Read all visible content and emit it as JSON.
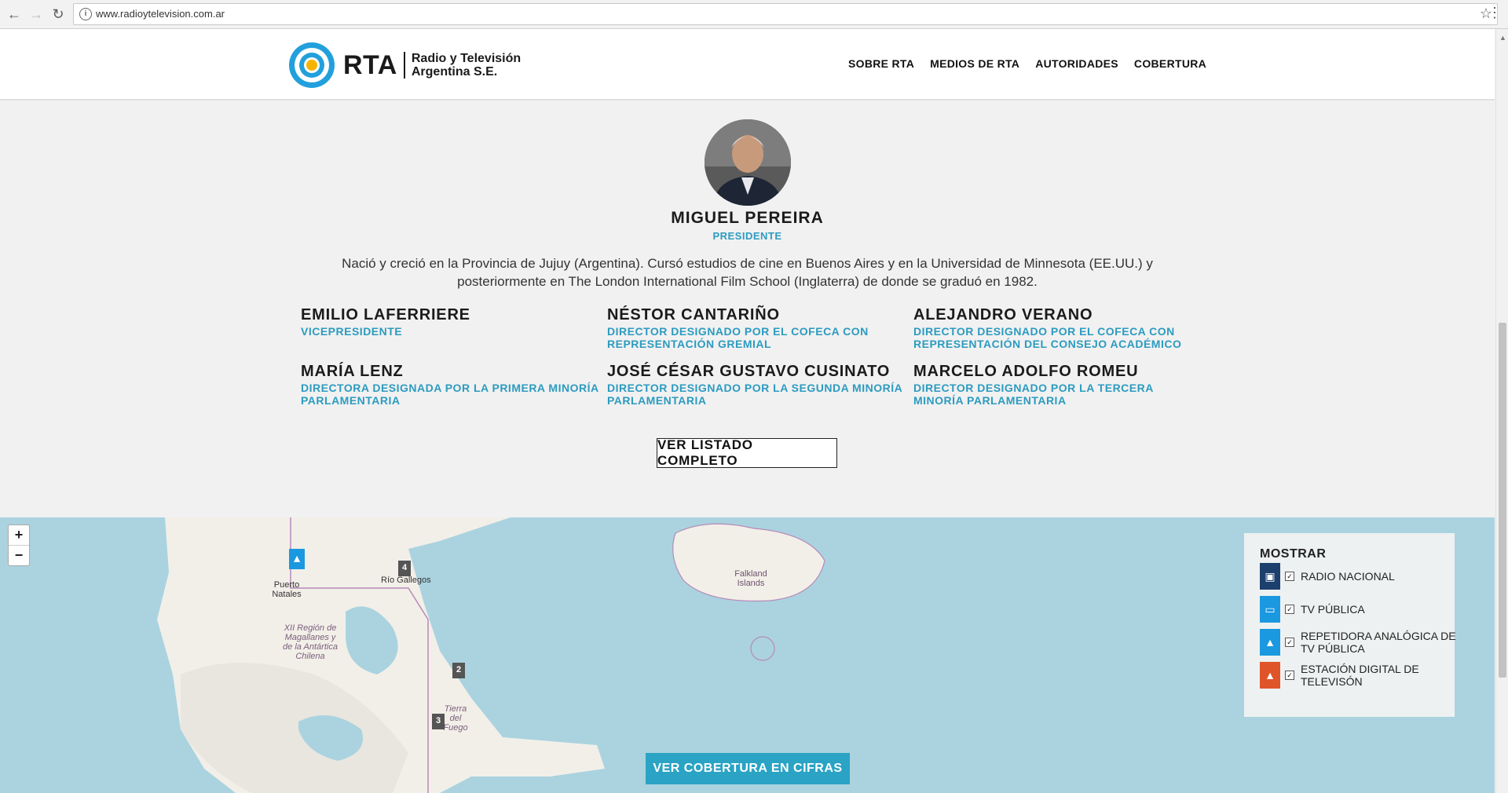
{
  "browser": {
    "url": "www.radioytelevision.com.ar"
  },
  "header": {
    "logo_abbr": "RTA",
    "logo_line1": "Radio y Televisión",
    "logo_line2": "Argentina S.E.",
    "nav": [
      "SOBRE RTA",
      "MEDIOS DE RTA",
      "AUTORIDADES",
      "COBERTURA"
    ]
  },
  "president": {
    "name": "MIGUEL PEREIRA",
    "role": "PRESIDENTE",
    "bio": "Nació y creció en la Provincia de Jujuy (Argentina). Cursó estudios de cine en Buenos Aires y en la Universidad de Minnesota (EE.UU.) y posteriormente en The London International Film School (Inglaterra) de donde se graduó en 1982."
  },
  "members": [
    {
      "name": "EMILIO LAFERRIERE",
      "role": "VICEPRESIDENTE"
    },
    {
      "name": "NÉSTOR CANTARIÑO",
      "role": "DIRECTOR DESIGNADO POR EL COFECA CON REPRESENTACIÓN GREMIAL"
    },
    {
      "name": "ALEJANDRO VERANO",
      "role": "DIRECTOR DESIGNADO POR EL COFECA CON REPRESENTACIÓN DEL CONSEJO ACADÉMICO"
    },
    {
      "name": "MARÍA LENZ",
      "role": "DIRECTORA DESIGNADA POR LA PRIMERA MINORÍA PARLAMENTARIA"
    },
    {
      "name": "JOSÉ CÉSAR GUSTAVO CUSINATO",
      "role": "DIRECTOR DESIGNADO POR LA SEGUNDA MINORÍA PARLAMENTARIA"
    },
    {
      "name": "MARCELO ADOLFO ROMEU",
      "role": "DIRECTOR DESIGNADO POR LA TERCERA MINORÍA PARLAMENTARIA"
    }
  ],
  "list_button": "VER LISTADO COMPLETO",
  "map": {
    "zoom_in": "+",
    "zoom_out": "−",
    "labels": {
      "puerto_natales": "Puerto Natales",
      "rio_gallegos": "Río Gallegos",
      "falkland": "Falkland Islands",
      "region": "XII Región de Magallanes y de la Antártica Chilena",
      "tierra_del_fuego": "Tierra del Fuego"
    },
    "clusters": [
      "4",
      "2",
      "3"
    ],
    "legend": {
      "title": "MOSTRAR",
      "items": [
        {
          "label": "RADIO NACIONAL",
          "icon": "radio-icon",
          "color": "#1d3f6e",
          "checked": true
        },
        {
          "label": "TV PÚBLICA",
          "icon": "tv-icon",
          "color": "#1a98e0",
          "checked": true
        },
        {
          "label": "REPETIDORA ANALÓGICA DE TV PÚBLICA",
          "icon": "antenna-icon",
          "color": "#1a98e0",
          "checked": true
        },
        {
          "label": "ESTACIÓN DIGITAL DE TELEVISÓN",
          "icon": "antenna-icon",
          "color": "#e0542a",
          "checked": true
        }
      ]
    },
    "cifras_button": "VER COBERTURA EN CIFRAS"
  }
}
